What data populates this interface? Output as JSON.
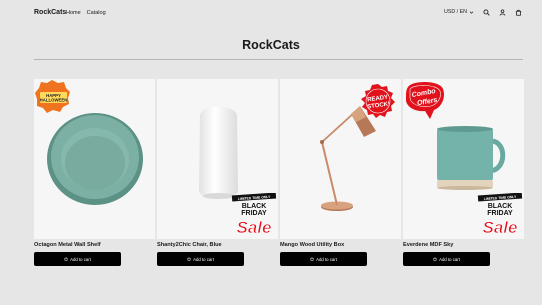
{
  "header": {
    "logo": "RockCats",
    "nav": [
      "Home",
      "Catalog"
    ],
    "locale": "USD / EN",
    "icons": [
      "search-icon",
      "account-icon",
      "cart-icon"
    ]
  },
  "page": {
    "title": "RockCats"
  },
  "products": [
    {
      "title": "Octagon Metal Wall Shelf",
      "button": "Add to cart",
      "badge": [
        "HAPPY",
        "HALLOWEEN"
      ]
    },
    {
      "title": "Shanty2Chic Chair, Blue",
      "button": "Add to cart",
      "badge": [
        "LIMITED TIME ONLY",
        "BLACK",
        "FRIDAY",
        "Sale"
      ]
    },
    {
      "title": "Mango Wood Utility Box",
      "button": "Add to cart",
      "badge": [
        "READY",
        "STOCK!"
      ]
    },
    {
      "title": "Everdene MDF Sky",
      "button": "Add to cart",
      "badge": [
        "Combo",
        "Offers"
      ],
      "badge2": [
        "LIMITED TIME ONLY",
        "BLACK",
        "FRIDAY",
        "Sale"
      ]
    }
  ],
  "colors": {
    "background": "#e6e6e6",
    "button": "#000000",
    "badge_orange": "#f0741f",
    "badge_red": "#e2121c"
  }
}
